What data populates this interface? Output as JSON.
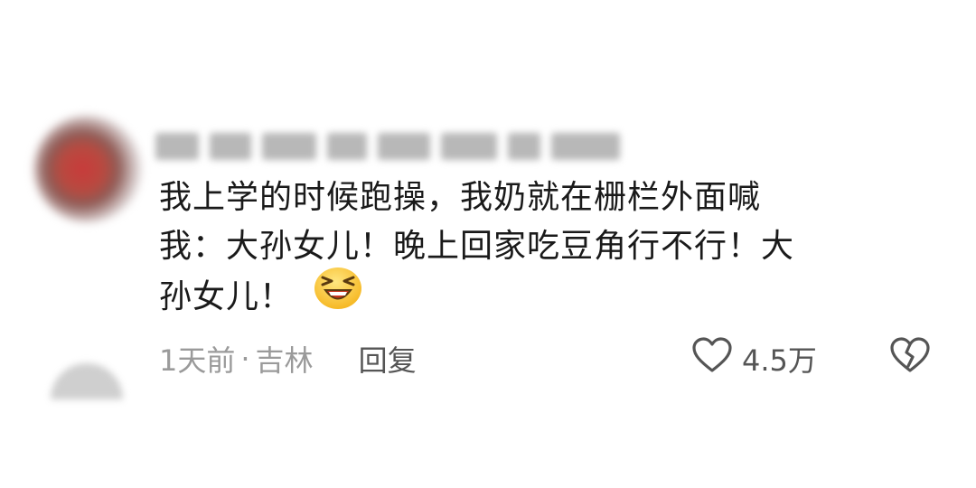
{
  "comment": {
    "lines": [
      "我上学的时候跑操，我奶就在栅栏外面喊",
      "我：大孙女儿！晚上回家吃豆角行不行！大",
      "孙女儿！"
    ],
    "emoji_icon": "laughing-squint-emoji-icon",
    "meta": {
      "time": "1天前",
      "separator": "·",
      "location": "吉林"
    },
    "reply_label": "回复",
    "likes": "4.5万",
    "like_icon": "heart-outline-icon",
    "dislike_icon": "broken-heart-icon"
  }
}
